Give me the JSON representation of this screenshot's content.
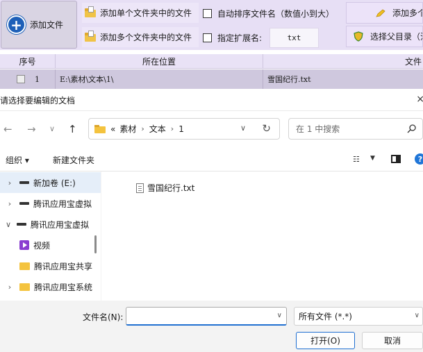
{
  "app": {
    "add_file_label": "添加文件",
    "add_single_folder_label": "添加单个文件夹中的文件",
    "add_multi_folder_label": "添加多个文件夹中的文件",
    "auto_sort_label": "自动排序文件名（数值小到大）",
    "specify_ext_label": "指定扩展名:",
    "ext_value": "txt",
    "add_multi_right_label": "添加多个",
    "choose_parent_label": "选择父目录（注",
    "table": {
      "headers": [
        "序号",
        "所在位置",
        "文件"
      ],
      "rows": [
        {
          "index": "1",
          "location": "E:\\素材\\文本\\1\\",
          "file": "雪国纪行.txt"
        }
      ]
    }
  },
  "dialog": {
    "title": "请选择要编辑的文档",
    "close_glyph": "×",
    "nav": {
      "back": "←",
      "forward": "→",
      "recent": "∨",
      "up": "↑"
    },
    "breadcrumb": {
      "overflow": "«",
      "parts": [
        "素材",
        "文本",
        "1"
      ],
      "separator": "›"
    },
    "search_placeholder": "在 1 中搜索",
    "toolbar": {
      "organize": "组织 ▾",
      "new_folder": "新建文件夹"
    },
    "tree": [
      {
        "label": "新加卷 (E:)",
        "icon": "drive-icon",
        "chevron": "›",
        "selected": true
      },
      {
        "label": "腾讯应用宝虚拟",
        "icon": "drive-icon",
        "chevron": "›",
        "selected": false
      },
      {
        "label": "腾讯应用宝虚拟",
        "icon": "drive-icon",
        "chevron": "∨",
        "selected": false
      },
      {
        "label": "视频",
        "icon": "video-icon",
        "chevron": "",
        "selected": false
      },
      {
        "label": "腾讯应用宝共享",
        "icon": "folder-icon",
        "chevron": "",
        "selected": false
      },
      {
        "label": "腾讯应用宝系统",
        "icon": "folder-icon",
        "chevron": "›",
        "selected": false
      }
    ],
    "files": [
      {
        "name": "雪国纪行.txt",
        "icon": "text-file-icon"
      }
    ],
    "filename_label": "文件名(N):",
    "filename_value": "",
    "filetype_value": "所有文件 (*.*)",
    "open_label": "打开(O)",
    "cancel_label": "取消"
  },
  "colors": {
    "toolbar_bg": "#e7dff5",
    "accent_blue": "#1f6fd1",
    "folder_yellow": "#f4c33e"
  }
}
